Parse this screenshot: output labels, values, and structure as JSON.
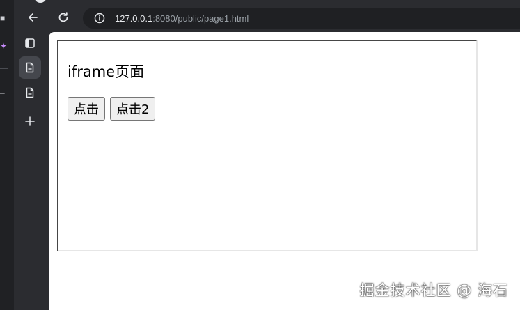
{
  "address_bar": {
    "host": "127.0.0.1",
    "path": ":8080/public/page1.html"
  },
  "iframe": {
    "heading": "iframe页面",
    "buttons": [
      "点击",
      "点击2"
    ]
  },
  "watermark": "掘金技术社区 @ 海石",
  "icons": {
    "back": "back-arrow-icon",
    "reload": "reload-icon",
    "site_info": "site-info-icon",
    "tab_actions": "tab-actions-icon",
    "page": "page-icon",
    "new_tab": "new-tab-icon"
  }
}
